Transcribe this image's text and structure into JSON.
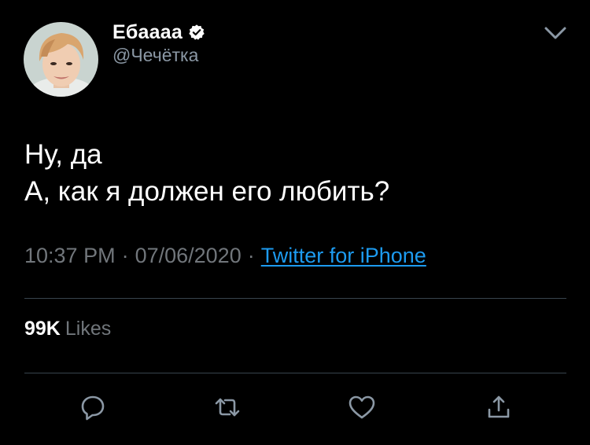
{
  "user": {
    "display_name": "Ебаааа",
    "handle": "@Чечётка",
    "verified": true
  },
  "tweet": {
    "lines": [
      "Ну, да",
      "А, как я должен его любить?"
    ],
    "time": "10:37 PM",
    "date": "07/06/2020",
    "separator": "·",
    "source": "Twitter for iPhone"
  },
  "stats": {
    "likes_count": "99K",
    "likes_label": "Likes"
  },
  "actions": [
    "reply-icon",
    "retweet-icon",
    "like-icon",
    "share-icon"
  ],
  "colors": {
    "background": "#000000",
    "text": "#ffffff",
    "secondary_text": "#71767b",
    "link": "#1d9bf0",
    "divider": "#38444d"
  }
}
